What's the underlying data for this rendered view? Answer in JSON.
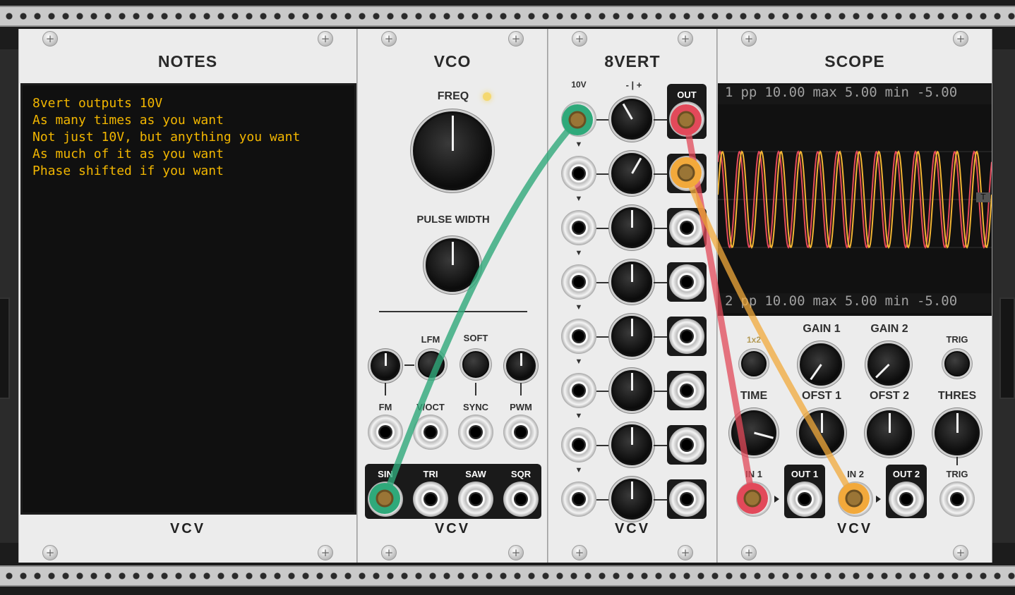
{
  "rack": {
    "brand": "VCV"
  },
  "notes": {
    "title": "NOTES",
    "lines": [
      "8vert outputs 10V",
      "As many times as you want",
      "Not just 10V, but anything you want",
      "As much of it as you want",
      "Phase shifted if you want"
    ]
  },
  "vco": {
    "title": "VCO",
    "freq_label": "FREQ",
    "pw_label": "PULSE WIDTH",
    "lfm_label": "LFM",
    "soft_label": "SOFT",
    "inputs": [
      "FM",
      "V/OCT",
      "SYNC",
      "PWM"
    ],
    "outputs": [
      "SIN",
      "TRI",
      "SAW",
      "SQR"
    ]
  },
  "eightvert": {
    "title": "8VERT",
    "in_label": "10V",
    "knob_label": "- | +",
    "out_label": "OUT",
    "arrow": "▼"
  },
  "scope": {
    "title": "SCOPE",
    "ch1": {
      "num": "1",
      "pp_label": "pp",
      "pp": "10.00",
      "max_label": "max",
      "max": "5.00",
      "min_label": "min",
      "min": "-5.00"
    },
    "ch2": {
      "num": "2",
      "pp_label": "pp",
      "pp": "10.00",
      "max_label": "max",
      "max": "5.00",
      "min_label": "min",
      "min": "-5.00"
    },
    "trigger_marker": "T",
    "mode_label": "1x2",
    "gain1_label": "GAIN 1",
    "gain2_label": "GAIN 2",
    "trig_button_label": "TRIG",
    "time_label": "TIME",
    "ofst1_label": "OFST 1",
    "ofst2_label": "OFST 2",
    "thres_label": "THRES",
    "in1_label": "IN 1",
    "out1_label": "OUT 1",
    "in2_label": "IN 2",
    "out2_label": "OUT 2",
    "trig_in_label": "TRIG"
  },
  "colors": {
    "cable_green": "#2fa97a",
    "cable_red": "#e2495a",
    "cable_yellow": "#f2a93b",
    "note_text": "#f2b600",
    "trace_red": "#e44a5c",
    "trace_yellow": "#f3b534"
  }
}
